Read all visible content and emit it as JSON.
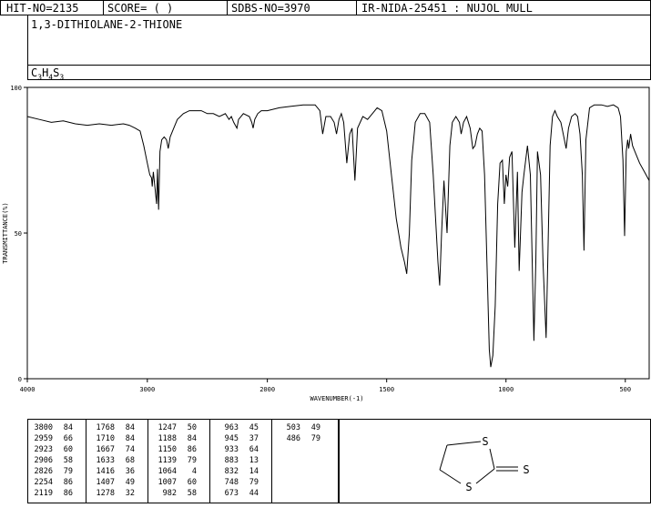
{
  "header": {
    "hit_no": "HIT-NO=2135",
    "score": "SCORE=  (  )",
    "sdbs_no": "SDBS-NO=3970",
    "ir_info": "IR-NIDA-25451 : NUJOL MULL"
  },
  "compound": {
    "name": "1,3-DITHIOLANE-2-THIONE",
    "formula_parts": {
      "c": "C",
      "c_n": "3",
      "h": "H",
      "h_n": "4",
      "s": "S",
      "s_n": "3"
    }
  },
  "chart_data": {
    "type": "line",
    "xlabel": "WAVENUMBER(-1)",
    "ylabel": "TRANSMITTANCE(%)",
    "xlim": [
      4000,
      400
    ],
    "ylim": [
      0,
      100
    ],
    "x_ticks": [
      4000,
      3000,
      2000,
      1500,
      1000,
      500
    ],
    "y_ticks": [
      0,
      50,
      100
    ],
    "grid": false,
    "series": [
      {
        "points": [
          [
            4000,
            90
          ],
          [
            3900,
            89
          ],
          [
            3800,
            88
          ],
          [
            3700,
            88.5
          ],
          [
            3600,
            87.5
          ],
          [
            3500,
            87
          ],
          [
            3400,
            87.5
          ],
          [
            3300,
            87
          ],
          [
            3200,
            87.5
          ],
          [
            3150,
            87
          ],
          [
            3100,
            86
          ],
          [
            3060,
            85
          ],
          [
            3030,
            80
          ],
          [
            3000,
            74
          ],
          [
            2980,
            70
          ],
          [
            2965,
            69
          ],
          [
            2959,
            66
          ],
          [
            2950,
            71
          ],
          [
            2935,
            65
          ],
          [
            2923,
            60
          ],
          [
            2915,
            72
          ],
          [
            2906,
            58
          ],
          [
            2895,
            78
          ],
          [
            2880,
            82
          ],
          [
            2860,
            83
          ],
          [
            2840,
            82
          ],
          [
            2826,
            79
          ],
          [
            2810,
            83
          ],
          [
            2780,
            86
          ],
          [
            2750,
            89
          ],
          [
            2700,
            91
          ],
          [
            2650,
            92
          ],
          [
            2600,
            92
          ],
          [
            2550,
            92
          ],
          [
            2500,
            91
          ],
          [
            2450,
            91
          ],
          [
            2400,
            90
          ],
          [
            2350,
            91
          ],
          [
            2320,
            89
          ],
          [
            2300,
            90
          ],
          [
            2280,
            88
          ],
          [
            2254,
            86
          ],
          [
            2240,
            89
          ],
          [
            2200,
            91
          ],
          [
            2150,
            90
          ],
          [
            2130,
            88
          ],
          [
            2119,
            86
          ],
          [
            2105,
            89
          ],
          [
            2080,
            91
          ],
          [
            2050,
            92
          ],
          [
            2000,
            92
          ],
          [
            1950,
            93
          ],
          [
            1900,
            93.5
          ],
          [
            1850,
            94
          ],
          [
            1800,
            94
          ],
          [
            1780,
            92
          ],
          [
            1768,
            84
          ],
          [
            1755,
            90
          ],
          [
            1735,
            90
          ],
          [
            1720,
            88
          ],
          [
            1710,
            84
          ],
          [
            1700,
            89
          ],
          [
            1690,
            91
          ],
          [
            1680,
            88
          ],
          [
            1667,
            74
          ],
          [
            1655,
            84
          ],
          [
            1645,
            86
          ],
          [
            1633,
            68
          ],
          [
            1622,
            86
          ],
          [
            1600,
            90
          ],
          [
            1580,
            89
          ],
          [
            1560,
            91
          ],
          [
            1540,
            93
          ],
          [
            1520,
            92
          ],
          [
            1500,
            85
          ],
          [
            1480,
            70
          ],
          [
            1460,
            55
          ],
          [
            1440,
            45
          ],
          [
            1425,
            40
          ],
          [
            1416,
            36
          ],
          [
            1405,
            50
          ],
          [
            1395,
            75
          ],
          [
            1380,
            88
          ],
          [
            1360,
            91
          ],
          [
            1340,
            91
          ],
          [
            1320,
            88
          ],
          [
            1305,
            70
          ],
          [
            1295,
            55
          ],
          [
            1285,
            40
          ],
          [
            1278,
            32
          ],
          [
            1270,
            50
          ],
          [
            1260,
            68
          ],
          [
            1247,
            50
          ],
          [
            1235,
            80
          ],
          [
            1225,
            88
          ],
          [
            1210,
            90
          ],
          [
            1195,
            88
          ],
          [
            1188,
            84
          ],
          [
            1178,
            88
          ],
          [
            1165,
            90
          ],
          [
            1150,
            86
          ],
          [
            1139,
            79
          ],
          [
            1130,
            80
          ],
          [
            1120,
            84
          ],
          [
            1110,
            86
          ],
          [
            1100,
            85
          ],
          [
            1090,
            70
          ],
          [
            1080,
            40
          ],
          [
            1070,
            10
          ],
          [
            1064,
            4
          ],
          [
            1055,
            8
          ],
          [
            1045,
            25
          ],
          [
            1035,
            60
          ],
          [
            1025,
            74
          ],
          [
            1015,
            75
          ],
          [
            1007,
            60
          ],
          [
            1000,
            70
          ],
          [
            993,
            66
          ],
          [
            985,
            76
          ],
          [
            975,
            78
          ],
          [
            963,
            45
          ],
          [
            952,
            71
          ],
          [
            945,
            37
          ],
          [
            933,
            64
          ],
          [
            925,
            70
          ],
          [
            910,
            80
          ],
          [
            898,
            70
          ],
          [
            883,
            13
          ],
          [
            875,
            40
          ],
          [
            868,
            78
          ],
          [
            855,
            70
          ],
          [
            845,
            40
          ],
          [
            832,
            14
          ],
          [
            825,
            40
          ],
          [
            815,
            80
          ],
          [
            805,
            90
          ],
          [
            795,
            92
          ],
          [
            785,
            90
          ],
          [
            770,
            88
          ],
          [
            760,
            84
          ],
          [
            748,
            79
          ],
          [
            738,
            86
          ],
          [
            725,
            90
          ],
          [
            710,
            91
          ],
          [
            700,
            90
          ],
          [
            690,
            84
          ],
          [
            680,
            70
          ],
          [
            673,
            44
          ],
          [
            665,
            82
          ],
          [
            650,
            93
          ],
          [
            630,
            94
          ],
          [
            600,
            94
          ],
          [
            575,
            93.5
          ],
          [
            550,
            94
          ],
          [
            530,
            93
          ],
          [
            520,
            90
          ],
          [
            510,
            75
          ],
          [
            503,
            49
          ],
          [
            496,
            78
          ],
          [
            490,
            82
          ],
          [
            486,
            79
          ],
          [
            478,
            84
          ],
          [
            470,
            80
          ],
          [
            460,
            78
          ],
          [
            450,
            76
          ],
          [
            440,
            74
          ],
          [
            420,
            71
          ],
          [
            400,
            68
          ]
        ]
      }
    ]
  },
  "peak_table": {
    "columns": [
      [
        [
          "3800",
          "84"
        ],
        [
          "2959",
          "66"
        ],
        [
          "2923",
          "60"
        ],
        [
          "2906",
          "58"
        ],
        [
          "2826",
          "79"
        ],
        [
          "2254",
          "86"
        ],
        [
          "2119",
          "86"
        ]
      ],
      [
        [
          "1768",
          "84"
        ],
        [
          "1710",
          "84"
        ],
        [
          "1667",
          "74"
        ],
        [
          "1633",
          "68"
        ],
        [
          "1416",
          "36"
        ],
        [
          "1407",
          "49"
        ],
        [
          "1278",
          "32"
        ]
      ],
      [
        [
          "1247",
          "50"
        ],
        [
          "1188",
          "84"
        ],
        [
          "1150",
          "86"
        ],
        [
          "1139",
          "79"
        ],
        [
          "1064",
          "4"
        ],
        [
          "1007",
          "60"
        ],
        [
          "982",
          "58"
        ]
      ],
      [
        [
          "963",
          "45"
        ],
        [
          "945",
          "37"
        ],
        [
          "933",
          "64"
        ],
        [
          "883",
          "13"
        ],
        [
          "832",
          "14"
        ],
        [
          "748",
          "79"
        ],
        [
          "673",
          "44"
        ]
      ],
      [
        [
          "503",
          "49"
        ],
        [
          "486",
          "79"
        ]
      ]
    ]
  },
  "structure": {
    "atom_s1": "S",
    "atom_s2": "S",
    "atom_s3": "S"
  }
}
